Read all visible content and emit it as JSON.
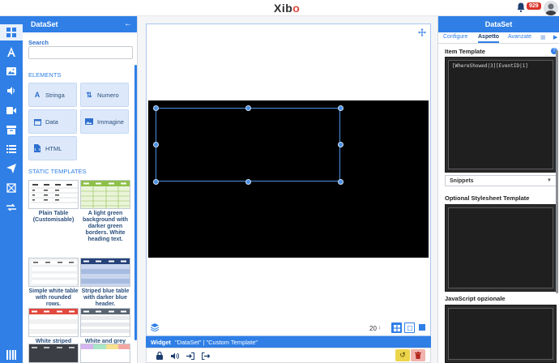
{
  "topbar": {
    "logo_x": "X",
    "logo_i": "ib",
    "logo_o": "o",
    "notification_count": "929"
  },
  "sidebar": {
    "title": "DataSet",
    "search_label": "Search",
    "elements_label": "ELEMENTS",
    "elements": [
      {
        "label": "Stringa",
        "icon": "text-icon"
      },
      {
        "label": "Numero",
        "icon": "sort-number-icon"
      },
      {
        "label": "Data",
        "icon": "calendar-icon"
      },
      {
        "label": "Immagine",
        "icon": "image-icon"
      },
      {
        "label": "HTML",
        "icon": "file-code-icon"
      }
    ],
    "templates_label": "STATIC TEMPLATES",
    "templates": [
      {
        "label": "Plain Table (Customisable)"
      },
      {
        "label": "A light green background with darker green borders. White heading text."
      },
      {
        "label": "Simple white table with rounded rows."
      },
      {
        "label": "Striped blue table with darker blue header."
      },
      {
        "label": "White striped table with orange header."
      },
      {
        "label": "White and grey table with split rows."
      }
    ]
  },
  "canvas": {
    "zoom_value": "20",
    "widget_label": "Widget",
    "widget_name": "\"DataSet\" | \"Custom Template\""
  },
  "rightpanel": {
    "title": "DataSet",
    "tabs": [
      "Configure",
      "Aspetto",
      "Avanzate"
    ],
    "item_template_label": "Item Template",
    "item_template_code": "[WhereShowed|3][EventID|1]",
    "snippets_label": "Snippets",
    "stylesheet_label": "Optional Stylesheet Template",
    "javascript_label": "JavaScript opzionale"
  },
  "colors": {
    "brand_blue": "#2f7fe6",
    "badge_red": "#d9342b",
    "undo_yellow": "#ecd54a"
  }
}
